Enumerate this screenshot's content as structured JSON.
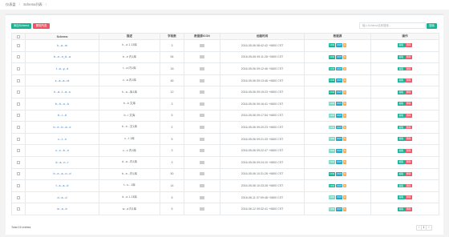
{
  "breadcrumb": {
    "home": "仪表盘",
    "current": "Schema列表"
  },
  "toolbar": {
    "add_label": "添加Schema",
    "delete_label": "删除所选",
    "search_placeholder": "输入Schema名称搜索...",
    "search_label": "搜索"
  },
  "table": {
    "headers": [
      "",
      "Schema",
      "描述",
      "字段数",
      "数据源ICON",
      "创建时间",
      "数据源",
      "操作"
    ],
    "rows": [
      {
        "name": "h...a...m",
        "desc": "h...a 1.13库",
        "fields": "3",
        "created": "2016-05-06 08:42:42 +0800 CST"
      },
      {
        "name": "b...e...n_d...a",
        "desc": "b...e 内1库",
        "fields": "54",
        "created": "2016-05-06 09:11:28 +0800 CST"
      },
      {
        "name": "t...a...y...d",
        "desc": "t...a 内1库",
        "fields": "18",
        "created": "2016-05-06 09:12:46 +0800 CST"
      },
      {
        "name": "z...a...a...nt",
        "desc": "z...a 内1库",
        "fields": "46",
        "created": "2016-05-06 09:13:46 +0800 CST"
      },
      {
        "name": "h...a...t...a...s",
        "desc": "h...a...库1库",
        "fields": "12",
        "created": "2016-05-06 09:15:23 +0800 CST"
      },
      {
        "name": "b...b...n...b",
        "desc": "b...b 文库",
        "fields": "3",
        "created": "2016-05-06 09:16:41 +0800 CST"
      },
      {
        "name": "b...i...d",
        "desc": "b...i 文库",
        "fields": "5",
        "created": "2016-05-06 09:17:54 +0800 CST"
      },
      {
        "name": "b...e...b...a...e",
        "desc": "b...e...文1库",
        "fields": "2",
        "created": "2016-05-06 09:20:23 +0800 CST"
      },
      {
        "name": "c...t...n",
        "desc": "c...t 1库",
        "fields": "5",
        "created": "2016-05-06 09:21:33 +0800 CST"
      },
      {
        "name": "c...c...b...n",
        "desc": "c...c 内1库",
        "fields": "3",
        "created": "2016-05-06 09:22:47 +0800 CST"
      },
      {
        "name": "d...a...n...r",
        "desc": "d...a...内1库",
        "fields": "3",
        "created": "2016-05-06 09:24:10 +0800 CST"
      },
      {
        "name": "b...e...a...n...d",
        "desc": "b...e...内1库",
        "fields": "50",
        "created": "2016-05-06 10:31:26 +0800 CST"
      },
      {
        "name": "t...s...a...d",
        "desc": "t...s...1库",
        "fields": "14",
        "created": "2016-05-06 10:33:28 +0800 CST"
      },
      {
        "name": "d...a...d",
        "desc": "d...a 1.13库",
        "fields": "5",
        "created": "2016-06-11 07:09:48 +0800 CST"
      },
      {
        "name": "w...a...b",
        "desc": "w...a 内1库",
        "fields": "5",
        "created": "2016-06-12 09:32:41 +0800 CST"
      }
    ],
    "tag_labels": [
      "CDM",
      "CMT",
      "N"
    ],
    "op_edit": "编辑",
    "op_delete": "删除"
  },
  "footer": {
    "total": "Total 15 entries",
    "prev": "‹",
    "page": "1",
    "next": "›"
  },
  "colors": {
    "primary": "#1ab394",
    "danger": "#ed5565",
    "info": "#23a9c7",
    "warning": "#f8ac59"
  }
}
